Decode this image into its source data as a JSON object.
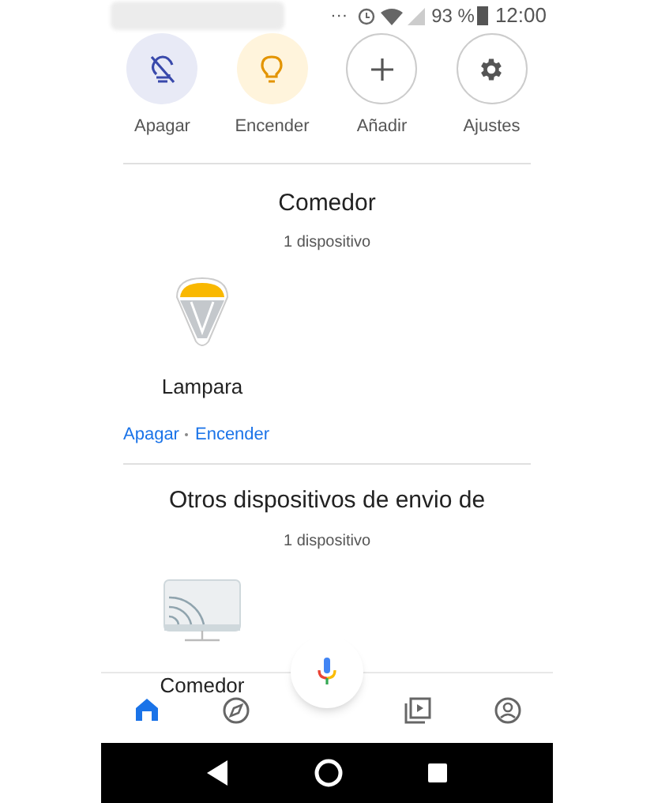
{
  "status_bar": {
    "overflow": "···",
    "battery": "93 %",
    "time": "12:00"
  },
  "quick_actions": [
    {
      "label": "Apagar",
      "kind": "light-off"
    },
    {
      "label": "Encender",
      "kind": "light-on"
    },
    {
      "label": "Añadir",
      "kind": "add"
    },
    {
      "label": "Ajustes",
      "kind": "settings"
    }
  ],
  "rooms": [
    {
      "title": "Comedor",
      "count": "1 dispositivo",
      "devices": [
        {
          "name": "Lampara",
          "kind": "lamp",
          "actions": [
            "Apagar",
            "Encender"
          ]
        }
      ]
    },
    {
      "title": "Otros dispositivos de envio de",
      "count": "1 dispositivo",
      "devices": [
        {
          "name": "Comedor",
          "kind": "cast"
        }
      ]
    }
  ],
  "bottom_nav": [
    {
      "kind": "home",
      "selected": true
    },
    {
      "kind": "explore",
      "selected": false
    },
    {
      "kind": "media",
      "selected": false
    },
    {
      "kind": "account",
      "selected": false
    }
  ]
}
